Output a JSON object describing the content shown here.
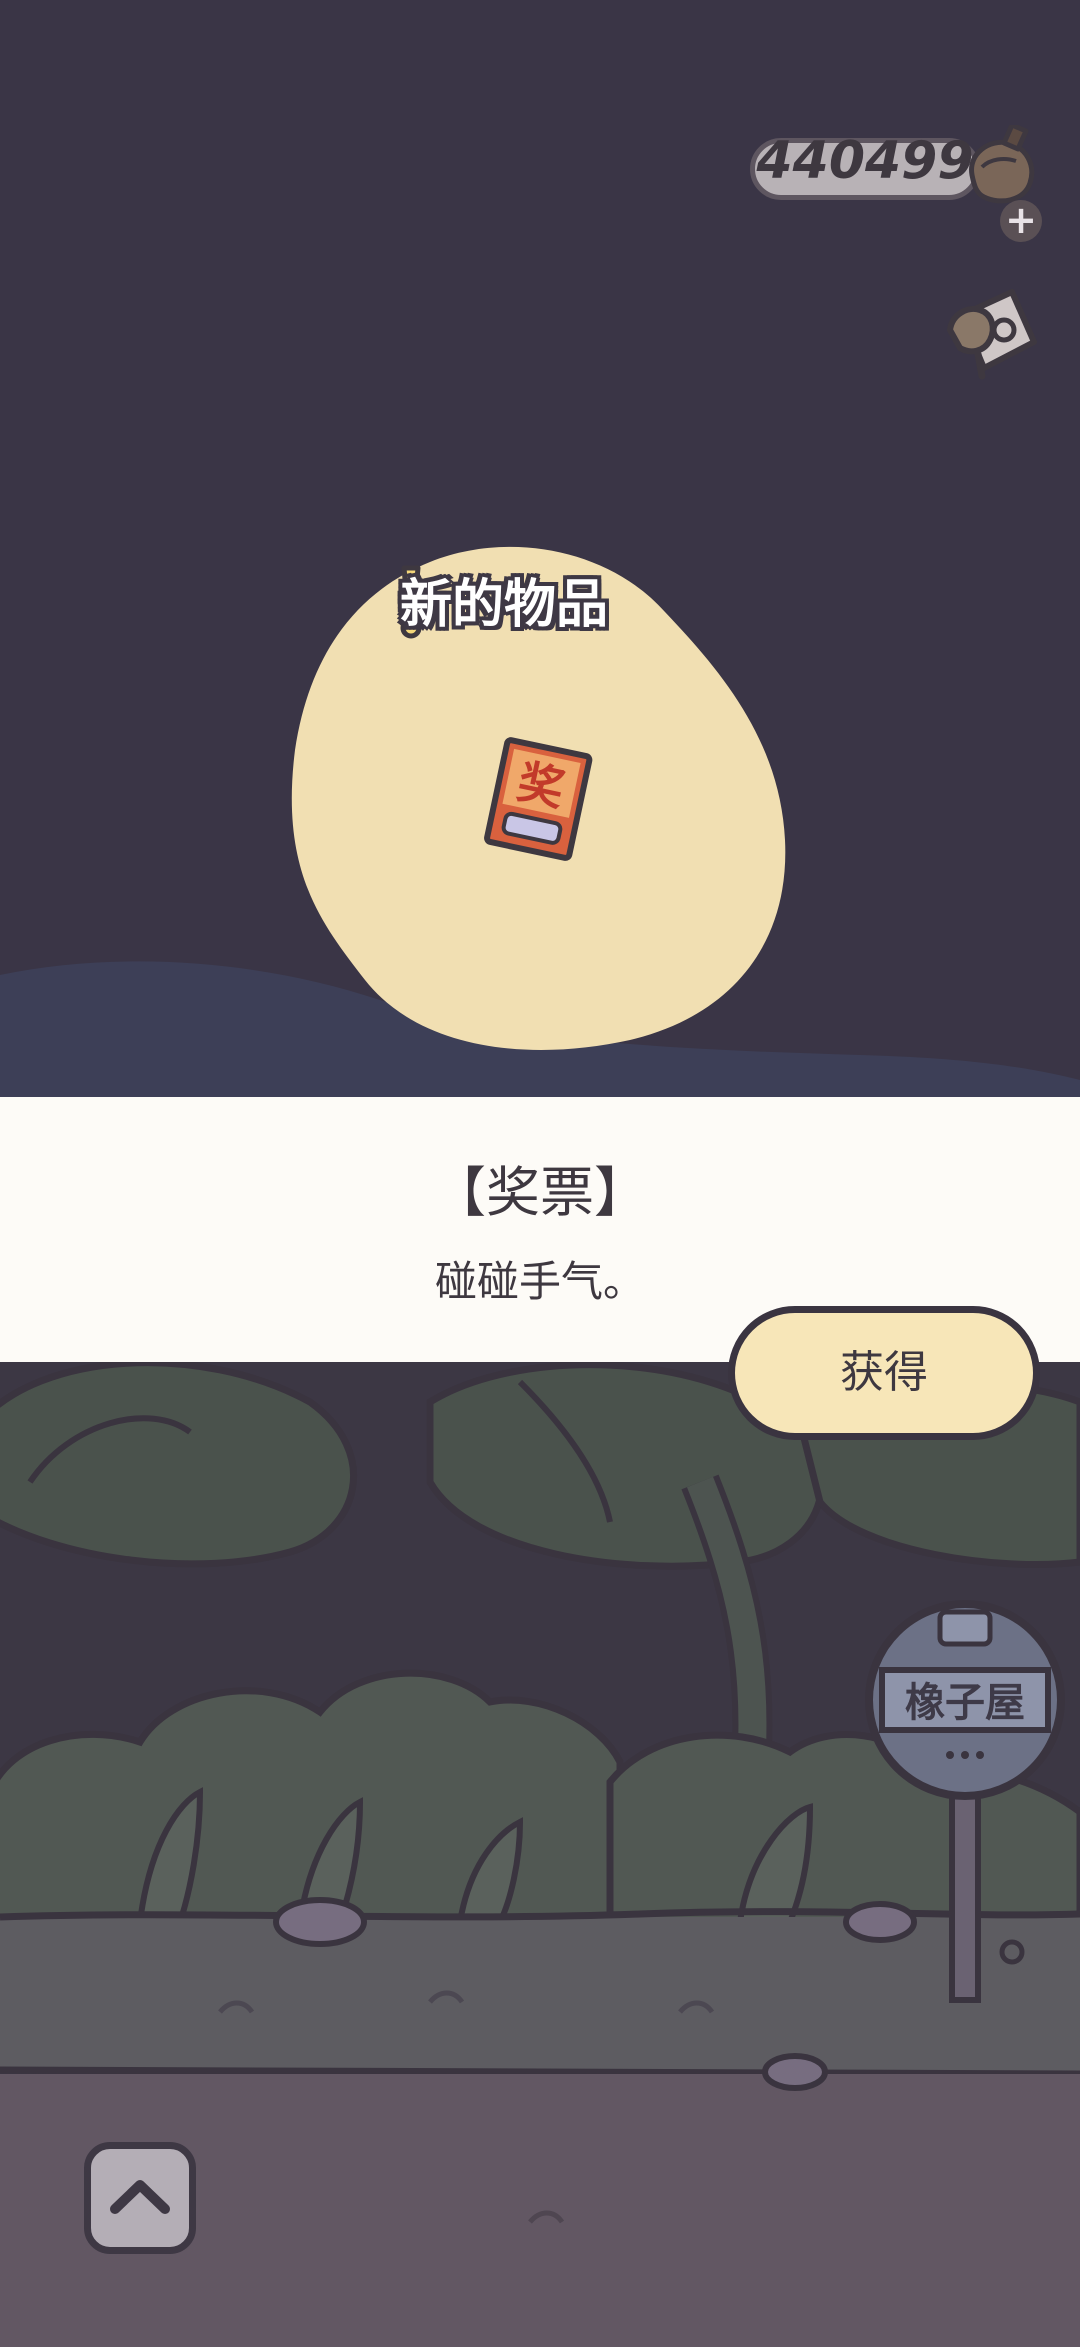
{
  "hud": {
    "clover_count": "440499",
    "plus_label": "+"
  },
  "popup": {
    "header": "新的物品",
    "item_name": "【奖票】",
    "item_description": "碰碰手气。",
    "item_icon": "lottery-ticket-icon",
    "ticket_glyph": "奖"
  },
  "actions": {
    "obtain_label": "获得"
  },
  "scene": {
    "bus_stop_sign": "橡子屋"
  },
  "colors": {
    "night_sky": "#3a3546",
    "popup_blob": "#f1dfb2",
    "info_band": "#fdfbf7",
    "button_fill": "#f7e6b8",
    "outline": "#3a3440"
  }
}
